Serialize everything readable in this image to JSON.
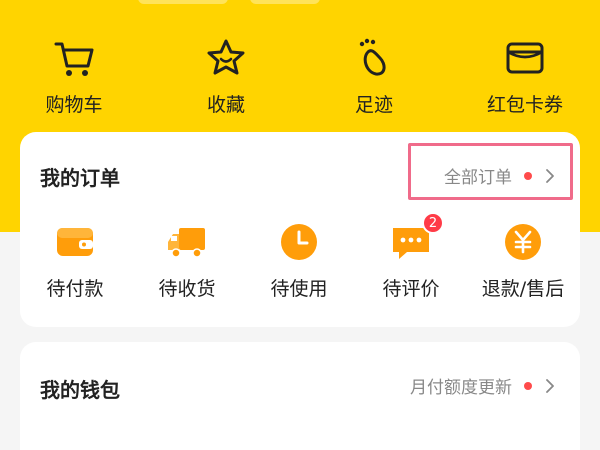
{
  "quick_actions": [
    {
      "label": "购物车",
      "icon": "cart-icon"
    },
    {
      "label": "收藏",
      "icon": "star-icon"
    },
    {
      "label": "足迹",
      "icon": "footprint-icon"
    },
    {
      "label": "红包卡券",
      "icon": "wallet-card-icon"
    }
  ],
  "orders": {
    "title": "我的订单",
    "link_label": "全部订单",
    "items": [
      {
        "label": "待付款",
        "icon": "wallet-icon"
      },
      {
        "label": "待收货",
        "icon": "truck-icon"
      },
      {
        "label": "待使用",
        "icon": "clock-icon"
      },
      {
        "label": "待评价",
        "icon": "comment-icon",
        "badge": "2"
      },
      {
        "label": "退款/售后",
        "icon": "yuan-refund-icon"
      }
    ]
  },
  "wallet": {
    "title": "我的钱包",
    "link_label": "月付额度更新"
  },
  "colors": {
    "brand_yellow": "#ffd400",
    "icon_orange": "#ff9d0a",
    "dot_red": "#ff4b4b",
    "highlight": "#f06b8a"
  }
}
